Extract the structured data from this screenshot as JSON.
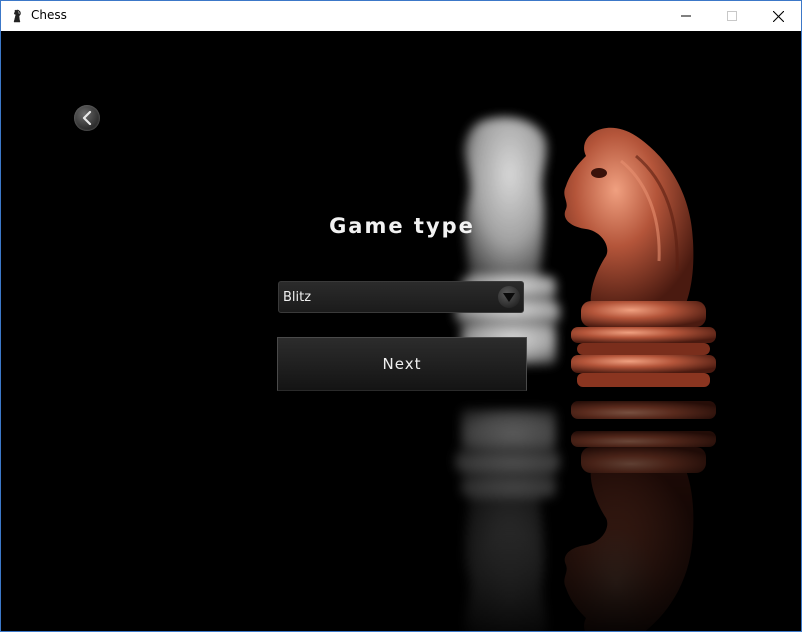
{
  "window": {
    "title": "Chess",
    "minimize_icon": "minimize-icon",
    "maximize_icon": "maximize-icon",
    "close_icon": "close-icon"
  },
  "screen": {
    "back_icon": "chevron-left-icon",
    "heading": "Game type",
    "game_type_select": {
      "selected": "Blitz",
      "arrow_icon": "chevron-down-icon"
    },
    "next_label": "Next"
  },
  "colors": {
    "background": "#000000",
    "text": "#f0f0f0",
    "copper_piece": "#b4553a",
    "silver_piece": "#d8d8d8"
  }
}
